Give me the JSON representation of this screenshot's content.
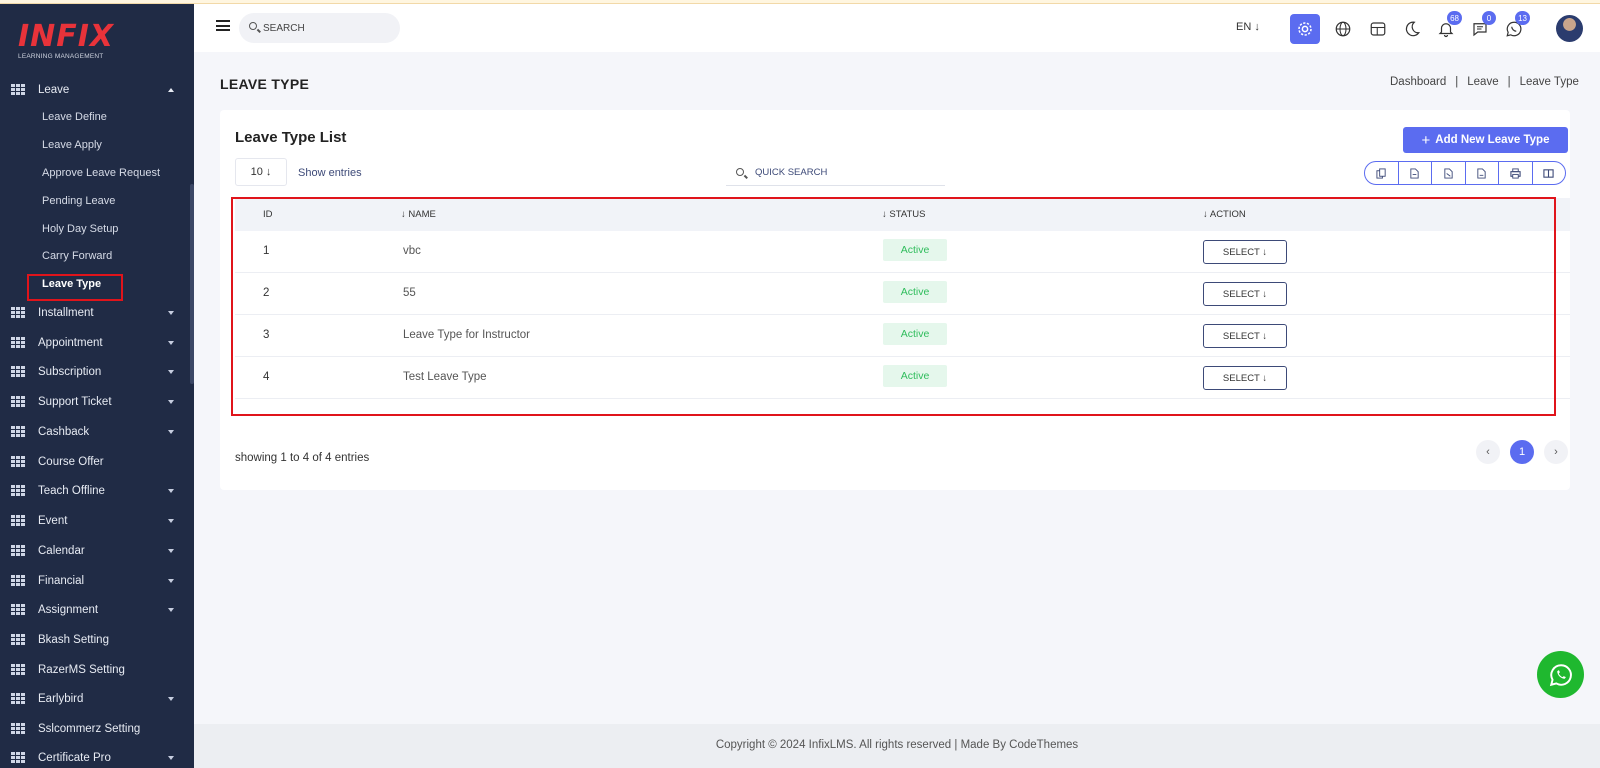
{
  "logo": {
    "brand": "INFIX",
    "subtitle": "LEARNING MANAGEMENT"
  },
  "sidebar": {
    "section": {
      "label": "Leave",
      "icon": "grid-icon"
    },
    "sub_items": [
      {
        "label": "Leave Define"
      },
      {
        "label": "Leave Apply"
      },
      {
        "label": "Approve Leave Request"
      },
      {
        "label": "Pending Leave"
      },
      {
        "label": "Holy Day Setup"
      },
      {
        "label": "Carry Forward"
      },
      {
        "label": "Leave Type",
        "active": true
      }
    ],
    "items": [
      {
        "label": "Installment",
        "caret": true
      },
      {
        "label": "Appointment",
        "caret": true
      },
      {
        "label": "Subscription",
        "caret": true
      },
      {
        "label": "Support Ticket",
        "caret": true
      },
      {
        "label": "Cashback",
        "caret": true
      },
      {
        "label": "Course Offer",
        "caret": false
      },
      {
        "label": "Teach Offline",
        "caret": true
      },
      {
        "label": "Event",
        "caret": true
      },
      {
        "label": "Calendar",
        "caret": true
      },
      {
        "label": "Financial",
        "caret": true
      },
      {
        "label": "Assignment",
        "caret": true
      },
      {
        "label": "Bkash Setting",
        "caret": false
      },
      {
        "label": "RazerMS Setting",
        "caret": false
      },
      {
        "label": "Earlybird",
        "caret": true
      },
      {
        "label": "Sslcommerz Setting",
        "caret": false
      },
      {
        "label": "Certificate Pro",
        "caret": true
      }
    ]
  },
  "header": {
    "search_placeholder": "SEARCH",
    "language": "EN ↓",
    "icons": [
      "settings-icon",
      "globe-icon",
      "layout-icon",
      "moon-icon",
      "bell-icon",
      "chat-icon",
      "whatsapp-icon"
    ],
    "badges": {
      "notifications": "68",
      "messages": "0",
      "whatsapp": "13"
    },
    "accent": "#5b6cf0"
  },
  "page": {
    "title": "LEAVE TYPE",
    "breadcrumb": [
      "Dashboard",
      "Leave",
      "Leave Type"
    ]
  },
  "card": {
    "title": "Leave Type List",
    "add_button": "Add New Leave Type",
    "page_size": "10 ↓",
    "show_entries": "Show entries",
    "quick_search_placeholder": "QUICK SEARCH",
    "export_icons": [
      "copy-icon",
      "csv-icon",
      "excel-icon",
      "pdf-icon",
      "print-icon",
      "columns-icon"
    ],
    "columns": {
      "id": "ID",
      "name": "↓ NAME",
      "status": "↓ STATUS",
      "action": "↓ ACTION"
    },
    "rows": [
      {
        "id": "1",
        "name": "vbc",
        "status": "Active",
        "action": "SELECT ↓"
      },
      {
        "id": "2",
        "name": "55",
        "status": "Active",
        "action": "SELECT ↓"
      },
      {
        "id": "3",
        "name": "Leave Type for Instructor",
        "status": "Active",
        "action": "SELECT ↓"
      },
      {
        "id": "4",
        "name": "Test Leave Type",
        "status": "Active",
        "action": "SELECT ↓"
      }
    ],
    "showing": "showing 1 to 4 of 4 entries",
    "pagination": {
      "prev": "‹",
      "current": "1",
      "next": "›"
    }
  },
  "footer": {
    "text": "Copyright © 2024 InfixLMS. All rights reserved | Made By CodeThemes"
  },
  "colors": {
    "sidebar_bg": "#202b45",
    "status_green": "#2fbd5c",
    "highlight_red": "#e0141b",
    "whatsapp_green": "#1fb82f"
  }
}
